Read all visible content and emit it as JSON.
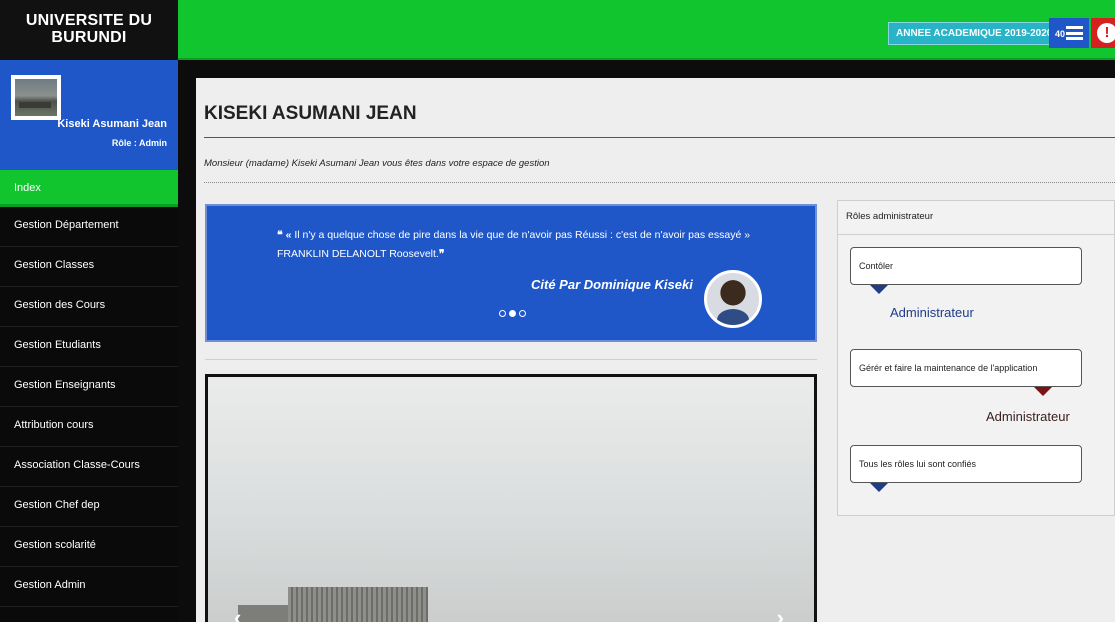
{
  "app": {
    "brand": "UNIVERSITE DU\nBURUNDI"
  },
  "profile": {
    "name": "Kiseki Asumani Jean",
    "role": "Rôle : Admin"
  },
  "sidebar": {
    "items": [
      {
        "label": "Index"
      },
      {
        "label": "Gestion Département"
      },
      {
        "label": "Gestion Classes"
      },
      {
        "label": "Gestion des Cours"
      },
      {
        "label": "Gestion Etudiants"
      },
      {
        "label": "Gestion Enseignants"
      },
      {
        "label": "Attribution cours"
      },
      {
        "label": "Association Classe-Cours"
      },
      {
        "label": "Gestion Chef dep"
      },
      {
        "label": "Gestion scolarité"
      },
      {
        "label": "Gestion Admin"
      }
    ],
    "active_index": 0
  },
  "topbar": {
    "year_label": "ANNEE ACADEMIQUE 2019-2020",
    "notif_count": "40",
    "alert_icon": "!"
  },
  "main": {
    "title": "KISEKI ASUMANI JEAN",
    "welcome": "Monsieur (madame) Kiseki Asumani Jean vous êtes dans votre espace de gestion"
  },
  "quote": {
    "open": "❝ «",
    "text": " Il n'y a quelque chose de pire dans la vie que de n'avoir pas Réussi : c'est de n'avoir pas essayé » FRANKLIN DELANOLT Roosevelt.",
    "close": "❞",
    "cited_by": "Cité Par Dominique Kiseki",
    "active_slide": 1,
    "slide_count": 3
  },
  "roles": {
    "heading": "Rôles administrateur",
    "items": [
      {
        "text": "Contôler",
        "who": "Administrateur"
      },
      {
        "text": "Gérér et faire la maintenance de l'application",
        "who": "Administrateur"
      },
      {
        "text": "Tous les rôles lui sont confiés",
        "who": ""
      }
    ]
  },
  "colors": {
    "green": "#11c52f",
    "blue": "#1f57c9",
    "teal": "#28b3c7",
    "red": "#d5211f"
  },
  "icons": {
    "notif": "bars-icon",
    "alert": "exclamation-icon",
    "prev": "chevron-left-icon",
    "next": "chevron-right-icon"
  }
}
